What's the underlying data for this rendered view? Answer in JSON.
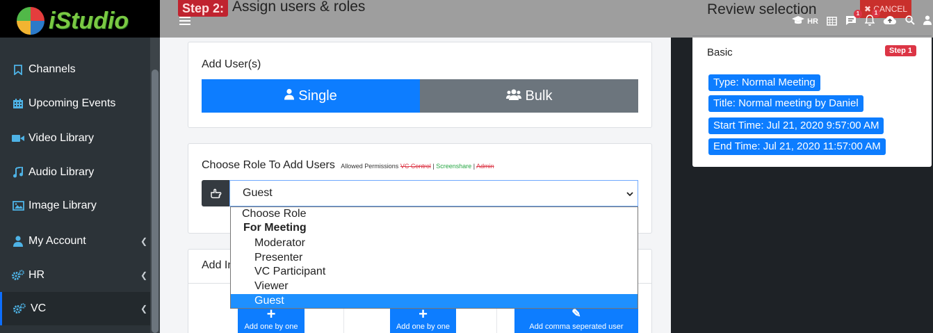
{
  "brand": {
    "logo_text": "iStudio"
  },
  "sidebar": {
    "items": [
      {
        "label": "Channels",
        "icon": "bookmark-icon",
        "has_children": false
      },
      {
        "label": "Upcoming Events",
        "icon": "calendar-icon",
        "has_children": false
      },
      {
        "label": "Video Library",
        "icon": "video-camera-icon",
        "has_children": false
      },
      {
        "label": "Audio Library",
        "icon": "music-note-icon",
        "has_children": false
      },
      {
        "label": "Image Library",
        "icon": "image-icon",
        "has_children": false
      },
      {
        "label": "My Account",
        "icon": "user-icon",
        "has_children": true
      },
      {
        "label": "HR",
        "icon": "gears-icon",
        "has_children": true
      },
      {
        "label": "VC",
        "icon": "gears-icon",
        "has_children": true,
        "active": true
      }
    ]
  },
  "header": {
    "step_tag": "Step 2:",
    "step_title": "Assign users & roles",
    "hr_label": "HR",
    "messages_badge": "1",
    "notifications_badge": "1",
    "cancel_label": "CANCEL"
  },
  "add_users": {
    "title": "Add User(s)",
    "single_label": "Single",
    "bulk_label": "Bulk"
  },
  "role": {
    "title": "Choose Role To Add Users",
    "allowed_label": "Allowed Permissions",
    "perm_vc": "VC Control",
    "perm_screenshare": "Screenshare",
    "perm_admin": "Admin",
    "sep1": "|",
    "sep2": "|",
    "selected": "Guest",
    "options": [
      {
        "label": "Choose Role",
        "group": false,
        "indent": false
      },
      {
        "label": "For Meeting",
        "group": true,
        "indent": false
      },
      {
        "label": "Moderator",
        "group": false,
        "indent": true
      },
      {
        "label": "Presenter",
        "group": false,
        "indent": true
      },
      {
        "label": "VC Participant",
        "group": false,
        "indent": true
      },
      {
        "label": "Viewer",
        "group": false,
        "indent": true
      },
      {
        "label": "Guest",
        "group": false,
        "indent": true,
        "highlighted": true
      }
    ]
  },
  "invite": {
    "title_partial": "Add In",
    "buttons": [
      {
        "label": "Add one by one"
      },
      {
        "label": "Add one by one"
      },
      {
        "label": "Add comma seperated user"
      }
    ]
  },
  "review": {
    "title": "Review selection",
    "section": "Basic",
    "step_badge": "Step 1",
    "chips": [
      "Type: Normal Meeting",
      "Title: Normal meeting by Daniel",
      "Start Time: Jul 21, 2020 9:57:00 AM",
      "End Time: Jul 21, 2020 11:57:00 AM"
    ]
  },
  "colors": {
    "primary": "#0d7dff",
    "secondary": "#6c757d",
    "danger": "#dc3545",
    "sidebar": "#2c3338"
  }
}
